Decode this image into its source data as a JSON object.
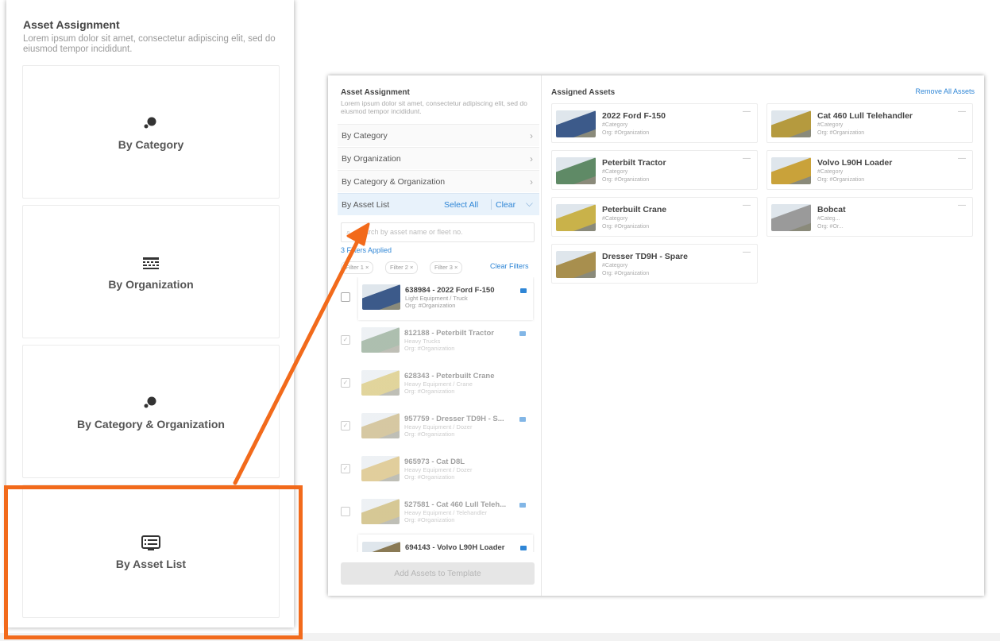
{
  "left_panel": {
    "title": "Asset Assignment",
    "description": "Lorem ipsum dolor sit amet, consectetur adipiscing elit, sed do eiusmod tempor incididunt.",
    "options": [
      {
        "label": "By Category",
        "icon": "category-icon"
      },
      {
        "label": "By Organization",
        "icon": "organization-icon"
      },
      {
        "label": "By Category & Organization",
        "icon": "category-organization-icon"
      },
      {
        "label": "By Asset List",
        "icon": "asset-list-icon"
      }
    ]
  },
  "right_panel": {
    "title": "Asset Assignment",
    "description": "Lorem ipsum dolor sit amet, consectetur adipiscing elit, sed do eiusmod tempor incididunt.",
    "accordion": {
      "by_category": "By Category",
      "by_organization": "By Organization",
      "by_cat_org": "By Category & Organization",
      "by_asset_list": "By Asset List",
      "select_all": "Select All",
      "clear": "Clear"
    },
    "search_placeholder": "Search by asset name or fleet no.",
    "filters_applied": "3 Filters Applied",
    "filter_chips": [
      "Filter 1  ×",
      "Filter 2  ×",
      "Filter 3  ×"
    ],
    "clear_filters": "Clear Filters",
    "asset_list": [
      {
        "name": "638984 - 2022 Ford F-150",
        "category": "Light Equipment / Truck",
        "org": "Org: #Organization",
        "checked": false,
        "thumb_color": "#3c5a8a"
      },
      {
        "name": "812188 - Peterbilt Tractor",
        "category": "Heavy Trucks",
        "org": "Org: #Organization",
        "checked": true,
        "thumb_color": "#6a8a6e"
      },
      {
        "name": "628343 - Peterbuilt Crane",
        "category": "Heavy Equipment / Crane",
        "org": "Org: #Organization",
        "checked": true,
        "thumb_color": "#c9b24a"
      },
      {
        "name": "957759 - Dresser TD9H - S...",
        "category": "Heavy Equipment / Dozer",
        "org": "Org: #Organization",
        "checked": true,
        "thumb_color": "#b59a55"
      },
      {
        "name": "965973 - Cat D8L",
        "category": "Heavy Equipment / Dozer",
        "org": "Org: #Organization",
        "checked": true,
        "thumb_color": "#c8a64c"
      },
      {
        "name": "527581 - Cat 460 Lull Teleh...",
        "category": "Heavy Equipment / Telehandler",
        "org": "Org: #Organization",
        "checked": false,
        "thumb_color": "#b59a3e"
      },
      {
        "name": "694143 - Volvo L90H Loader",
        "category": "",
        "org": "",
        "checked": false,
        "thumb_color": "#8a7a55"
      }
    ],
    "add_button": "Add Assets to Template",
    "assigned_title": "Assigned Assets",
    "remove_all": "Remove All Assets",
    "assigned": [
      {
        "name": "2022 Ford F-150",
        "category": "#Category",
        "org": "Org: #Organization",
        "thumb_color": "#3c5a8a"
      },
      {
        "name": "Cat 460 Lull Telehandler",
        "category": "#Category",
        "org": "Org: #Organization",
        "thumb_color": "#b59a3e"
      },
      {
        "name": "Peterbilt Tractor",
        "category": "#Category",
        "org": "Org: #Organization",
        "thumb_color": "#5f8a66"
      },
      {
        "name": "Volvo L90H Loader",
        "category": "#Category",
        "org": "Org: #Organization",
        "thumb_color": "#c9a23a"
      },
      {
        "name": "Peterbuilt Crane",
        "category": "#Category",
        "org": "Org: #Organization",
        "thumb_color": "#c9b24a"
      },
      {
        "name": "Bobcat",
        "category": "#Categ...",
        "org": "Org: #Or...",
        "thumb_color": "#9a9a9a"
      },
      {
        "name": "Dresser TD9H - Spare",
        "category": "#Category",
        "org": "Org: #Organization",
        "thumb_color": "#a88f4e"
      }
    ],
    "more_glyph": "—"
  },
  "colors": {
    "highlight": "#f26a1b",
    "link": "#2f86d6"
  }
}
